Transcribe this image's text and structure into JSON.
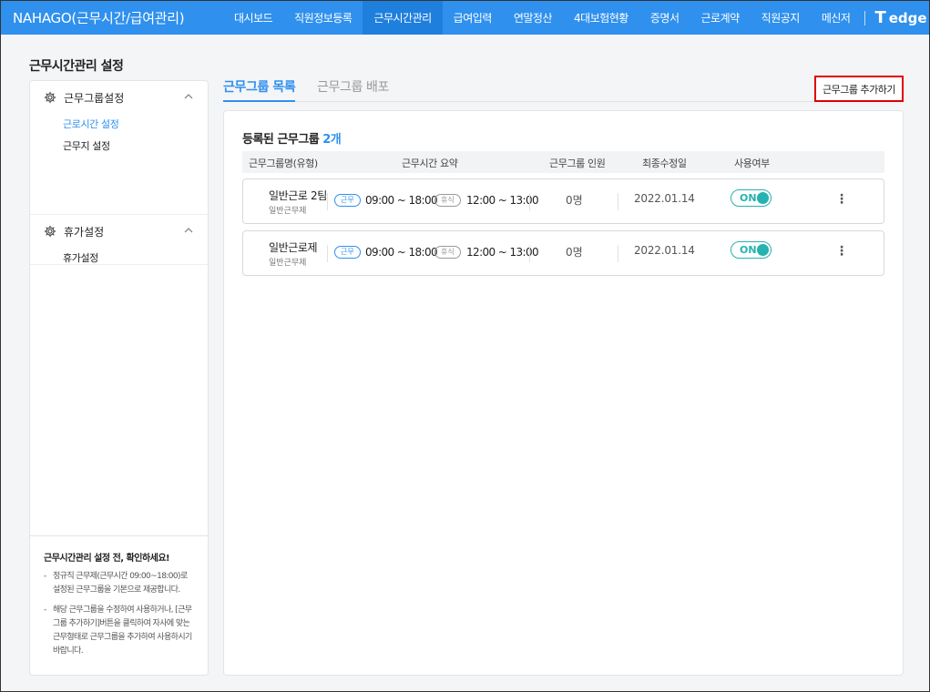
{
  "header": {
    "app_title": "NAHAGO(근무시간/급여관리)",
    "nav": [
      "대시보드",
      "직원정보등록",
      "근무시간관리",
      "급여입력",
      "연말정산",
      "4대보험현황",
      "증명서",
      "근로계약",
      "직원공지",
      "메신저"
    ],
    "active_nav": "근무시간관리",
    "logo_text": "edge",
    "logo_mark": "T",
    "brand_color": "#2f90ee"
  },
  "page": {
    "title": "근무시간관리 설정"
  },
  "sidebar": {
    "groups": [
      {
        "label": "근무그룹설정",
        "items": [
          "근로시간 설정",
          "근무지 설정"
        ],
        "active_item": "근로시간 설정"
      },
      {
        "label": "휴가설정",
        "items": [
          "휴가설정"
        ]
      }
    ],
    "notice": {
      "title": "근무시간관리 설정 전, 확인하세요!",
      "items": [
        "정규직 근무제(근무시간 09:00~18:00)로 설정된 근무그룹을 기본으로 제공합니다.",
        "해당 근무그룹을 수정하여 사용하거나, [근무그룹 추가하기]버튼을 클릭하여 자사에 맞는 근무형태로 근무그룹을 추가하여 사용하시기 바랍니다."
      ]
    }
  },
  "tabs": [
    "근무그룹 목록",
    "근무그룹 배포"
  ],
  "active_tab": "근무그룹 목록",
  "add_button": "근무그룹 추가하기",
  "list": {
    "title": "등록된 근무그룹",
    "count": "2개",
    "columns": [
      "근무그룹명(유형)",
      "근무시간 요약",
      "근무그룹 인원",
      "최종수정일",
      "사용여부"
    ],
    "rows": [
      {
        "name": "일반근로 2팀",
        "type": "일반근무제",
        "work_tag": "근무",
        "work_time": "09:00 ~ 18:00",
        "rest_tag": "휴식",
        "rest_time": "12:00 ~ 13:00",
        "members": "0명",
        "date": "2022.01.14",
        "status": "ON"
      },
      {
        "name": "일반근로제",
        "type": "일반근무제",
        "work_tag": "근무",
        "work_time": "09:00 ~ 18:00",
        "rest_tag": "휴식",
        "rest_time": "12:00 ~ 13:00",
        "members": "0명",
        "date": "2022.01.14",
        "status": "ON"
      }
    ]
  }
}
